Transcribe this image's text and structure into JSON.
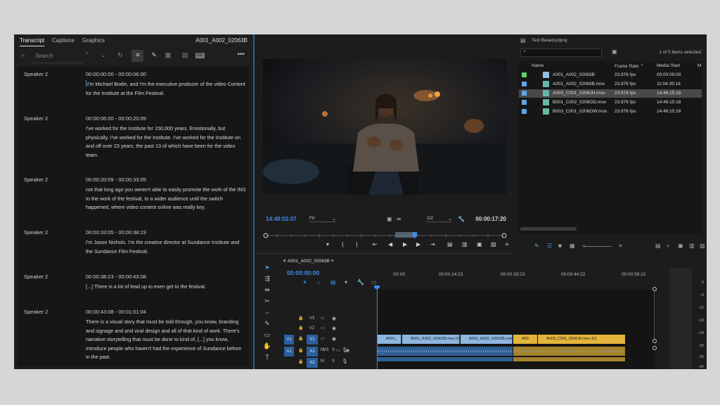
{
  "transcript": {
    "tabs": [
      "Transcript",
      "Captions",
      "Graphics"
    ],
    "clip_name": "A001_A002_02063B",
    "search_placeholder": "Search",
    "segments": [
      {
        "speaker": "Speaker 2",
        "timecode": "00:00:00:00 - 00:00:06:00",
        "text": "I'm Michael Bodie, and I'm the executive producer of the video Content for the Institute at the Film Festival."
      },
      {
        "speaker": "Speaker 2",
        "timecode": "00:00:06:00 - 00:00:20:09",
        "text": "I've worked for the Institute for 150,000 years. Emotionally, but physically. I've worked for the Institute. I've worked for the Institute on and off over 23 years, the past 13 of which have been for the video team."
      },
      {
        "speaker": "Speaker 2",
        "timecode": "00:00:20:09 - 00:00:33:05",
        "text": "not that long ago you weren't able to easily promote the work of the INS to the work of the festival, to a wider audience until the switch happened, where video content online was really key."
      },
      {
        "speaker": "Speaker 2",
        "timecode": "00:00:33:05 - 00:00:38:23",
        "text": "I'm Jason Nichols. I'm the creative director at Sundance Institute and the Sundance Film Festival."
      },
      {
        "speaker": "Speaker 2",
        "timecode": "00:00:38:23 - 00:00:43:08",
        "text": "[...] There is a lot of lead up to even get to the festival."
      },
      {
        "speaker": "Speaker 2",
        "timecode": "00:00:43:08 - 00:01:01:04",
        "text": "There is a visual story that must be told through, you know, branding and signage and and viral design and all of that kind of work. There's narrative storytelling that must be done to kind of, [...] you know, introduce people who haven't had the experience of Sundance before in the past."
      }
    ]
  },
  "monitor": {
    "current_timecode": "14:48:52:07",
    "zoom": "Fit",
    "resolution": "1/2",
    "duration": "00:00:17:20"
  },
  "project": {
    "name": "Text Based.prproj",
    "items_selected": "1 of 5 items selected",
    "columns": [
      "Name",
      "Frame Rate",
      "Media Start",
      "M"
    ],
    "rows": [
      {
        "name": "A001_A002_02063B",
        "fps": "23.976 fps",
        "start": "00:00:00:00",
        "color": "#5bd16a",
        "selected": false
      },
      {
        "name": "A001_A002_02063B.mov",
        "fps": "23.976 fps",
        "start": "11:04:35:16",
        "color": "#5ea6e6",
        "selected": false
      },
      {
        "name": "A003_C001_0206JH.mov",
        "fps": "23.976 fps",
        "start": "14:46:15:18",
        "color": "#5ea6e6",
        "selected": true
      },
      {
        "name": "B001_C002_0206OD.mov",
        "fps": "23.976 fps",
        "start": "14:46:15:18",
        "color": "#5ea6e6",
        "selected": false
      },
      {
        "name": "B003_C001_0206OW.mov",
        "fps": "23.976 fps",
        "start": "14:46:15:18",
        "color": "#5ea6e6",
        "selected": false
      }
    ]
  },
  "timeline": {
    "sequence_name": "A001_A002_02063B",
    "timecode": "00:00:00:00",
    "ticks": [
      ":00:00",
      "00:00:14:23",
      "00:00:29:23",
      "00:00:44:22",
      "00:00:59:22"
    ],
    "tracks": {
      "v3": "V3",
      "v2": "V2",
      "v1": "V1",
      "a1": "A1",
      "a2": "A2",
      "src_v1": "V1",
      "src_a1": "A1"
    },
    "clips": {
      "c1": "A001_",
      "c2": "A001_A002_02063B.mov [V]",
      "c3": "A001_A002_02063B.mov [V]",
      "c4": "A00",
      "c5": "A003_C001_0206JH.mov [V]"
    },
    "meter_db": [
      "0",
      "-6",
      "-12",
      "-18",
      "-24",
      "-30",
      "-36",
      "-42"
    ]
  }
}
